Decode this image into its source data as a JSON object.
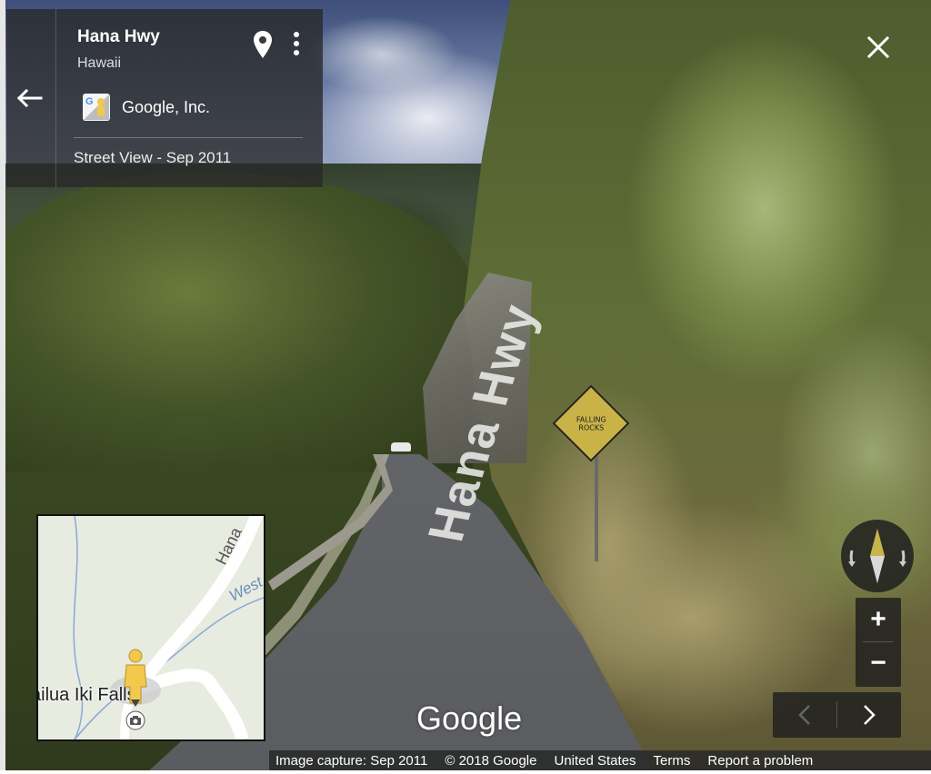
{
  "info_card": {
    "title": "Hana Hwy",
    "subtitle": "Hawaii",
    "provider": "Google, Inc.",
    "capture_info": "Street View - Sep 2011"
  },
  "scene": {
    "road_text": "Hana Hwy",
    "sign_text_line1": "FALLING",
    "sign_text_line2": "ROCKS"
  },
  "minimap": {
    "label_falls": "ailua Iki Falls",
    "label_road": "Hana",
    "label_stream": "West W"
  },
  "zoom": {
    "in_label": "+",
    "out_label": "−"
  },
  "watermark": "Google",
  "footer": {
    "capture": "Image capture: Sep 2011",
    "copyright": "© 2018 Google",
    "region": "United States",
    "terms": "Terms",
    "report": "Report a problem"
  },
  "colors": {
    "card_bg": "#282828",
    "pegman": "#f2c94c",
    "compass_north": "#c7b44a"
  },
  "icons": [
    "back-arrow-icon",
    "pin-icon",
    "more-vert-icon",
    "close-icon",
    "compass-icon",
    "pegman-icon",
    "camera-icon",
    "chevron-left-icon",
    "chevron-right-icon"
  ]
}
